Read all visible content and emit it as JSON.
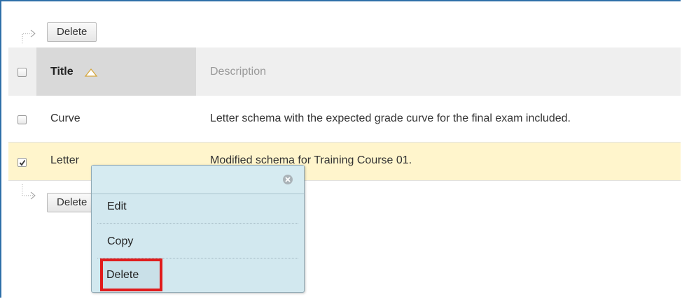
{
  "toolbar": {
    "delete_label": "Delete"
  },
  "table": {
    "columns": {
      "title": "Title",
      "description": "Description"
    },
    "rows": [
      {
        "title": "Curve",
        "description": "Letter schema with the expected grade curve for the final exam included.",
        "checked": false
      },
      {
        "title": "Letter",
        "description": "Modified schema for Training Course 01.",
        "checked": true
      }
    ]
  },
  "bottom_toolbar": {
    "delete_label": "Delete"
  },
  "context_menu": {
    "items": [
      "Edit",
      "Copy",
      "Delete"
    ],
    "highlight_color": "#e01c1c"
  },
  "colors": {
    "selected_row": "#fff5cc",
    "menu_bg": "#d2e8ef",
    "frame": "#2f6fa8"
  }
}
